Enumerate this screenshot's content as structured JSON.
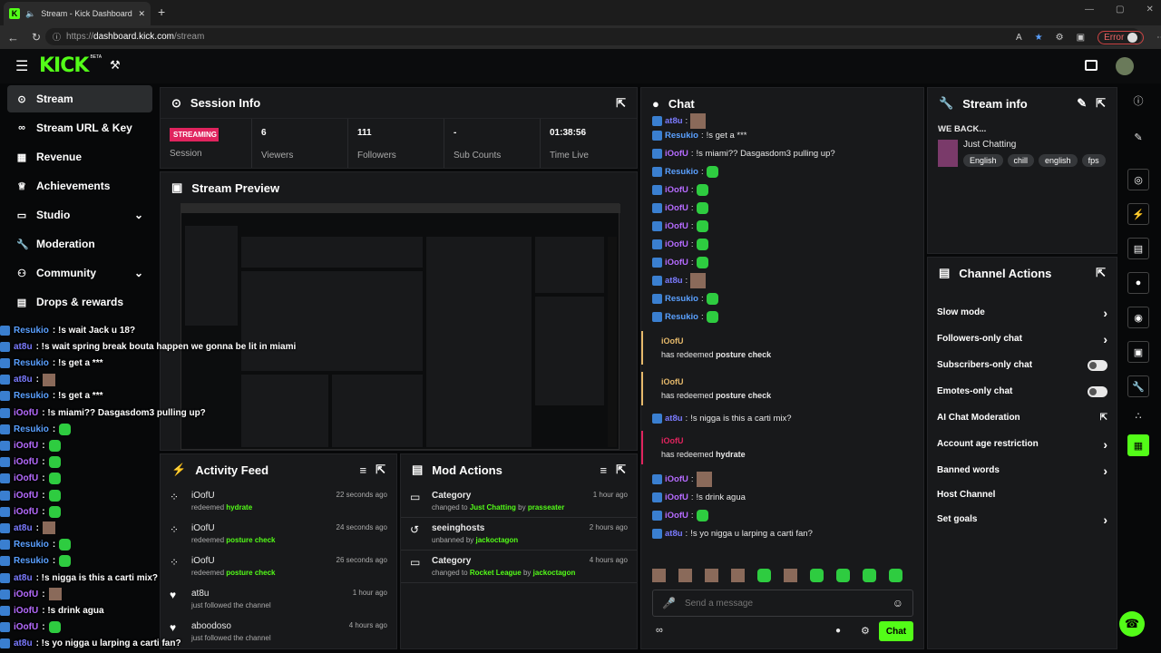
{
  "browser": {
    "tab_title": "Stream - Kick Dashboard",
    "url_prefix": "https://",
    "url_domain": "dashboard.kick.com",
    "url_path": "/stream",
    "error_label": "Error"
  },
  "app": {
    "logo": "KICK",
    "beta": "BETA"
  },
  "sidebar": {
    "items": [
      {
        "label": "Stream",
        "icon": "broadcast-icon"
      },
      {
        "label": "Stream URL & Key",
        "icon": "link-icon"
      },
      {
        "label": "Revenue",
        "icon": "revenue-icon"
      },
      {
        "label": "Achievements",
        "icon": "trophy-icon"
      },
      {
        "label": "Studio",
        "icon": "studio-icon"
      },
      {
        "label": "Moderation",
        "icon": "wrench-icon"
      },
      {
        "label": "Community",
        "icon": "community-icon"
      },
      {
        "label": "Drops & rewards",
        "icon": "drops-icon"
      }
    ]
  },
  "session": {
    "title": "Session Info",
    "status": "STREAMING",
    "status_label": "Session",
    "stats": [
      {
        "value": "6",
        "label": "Viewers"
      },
      {
        "value": "111",
        "label": "Followers"
      },
      {
        "value": "-",
        "label": "Sub Counts"
      },
      {
        "value": "01:38:56",
        "label": "Time Live"
      }
    ]
  },
  "preview": {
    "title": "Stream Preview"
  },
  "activity": {
    "title": "Activity Feed",
    "items": [
      {
        "user": "iOofU",
        "verb": "redeemed",
        "item": "hydrate",
        "time": "22 seconds ago",
        "icon": "redeem-icon"
      },
      {
        "user": "iOofU",
        "verb": "redeemed",
        "item": "posture check",
        "time": "24 seconds ago",
        "icon": "redeem-icon"
      },
      {
        "user": "iOofU",
        "verb": "redeemed",
        "item": "posture check",
        "time": "26 seconds ago",
        "icon": "redeem-icon"
      },
      {
        "user": "at8u",
        "verb": "just followed the channel",
        "item": "",
        "time": "1 hour ago",
        "icon": "heart-icon"
      },
      {
        "user": "aboodoso",
        "verb": "just followed the channel",
        "item": "",
        "time": "4 hours ago",
        "icon": "heart-icon"
      }
    ]
  },
  "modactions": {
    "title": "Mod Actions",
    "items": [
      {
        "title": "Category",
        "pre": "changed to",
        "target": "Just Chatting",
        "by": "by",
        "mod": "prasseater",
        "time": "1 hour ago"
      },
      {
        "title": "seeinghosts",
        "pre": "unbanned by",
        "target": "",
        "by": "",
        "mod": "jackoctagon",
        "time": "2 hours ago"
      },
      {
        "title": "Category",
        "pre": "changed to",
        "target": "Rocket League",
        "by": "by",
        "mod": "jackoctagon",
        "time": "4 hours ago"
      }
    ]
  },
  "chat": {
    "title": "Chat",
    "messages": [
      {
        "user": "at8u",
        "text": "",
        "emote": "pic",
        "color": "#7b7bff"
      },
      {
        "user": "Resukio",
        "text": "!s get a ***",
        "emote": "",
        "color": "#5aa0ff"
      },
      {
        "user": "iOofU",
        "text": "!s miami?? Dasgasdom3 pulling up?",
        "emote": "",
        "color": "#b56bff"
      },
      {
        "user": "Resukio",
        "text": "",
        "emote": "green",
        "color": "#5aa0ff"
      },
      {
        "user": "iOofU",
        "text": "",
        "emote": "green",
        "color": "#b56bff"
      },
      {
        "user": "iOofU",
        "text": "",
        "emote": "green",
        "color": "#b56bff"
      },
      {
        "user": "iOofU",
        "text": "",
        "emote": "green",
        "color": "#b56bff"
      },
      {
        "user": "iOofU",
        "text": "",
        "emote": "green",
        "color": "#b56bff"
      },
      {
        "user": "iOofU",
        "text": "",
        "emote": "green",
        "color": "#b56bff"
      },
      {
        "user": "at8u",
        "text": "",
        "emote": "pic",
        "color": "#7b7bff"
      },
      {
        "user": "Resukio",
        "text": "",
        "emote": "green",
        "color": "#5aa0ff"
      },
      {
        "user": "Resukio",
        "text": "",
        "emote": "green",
        "color": "#5aa0ff"
      }
    ],
    "redeems": [
      {
        "user": "iOofU",
        "label": "has redeemed",
        "item": "posture check",
        "accent": "#e5b96b"
      },
      {
        "user": "iOofU",
        "label": "has redeemed",
        "item": "posture check",
        "accent": "#e5b96b"
      }
    ],
    "mid_line": {
      "user": "at8u",
      "text": "!s nigga is this a carti mix?"
    },
    "redeem_hydrate": {
      "user": "iOofU",
      "label": "has redeemed",
      "item": "hydrate",
      "accent": "#e0245e"
    },
    "tail": [
      {
        "user": "iOofU",
        "text": "",
        "emote": "pic",
        "color": "#b56bff"
      },
      {
        "user": "iOofU",
        "text": "!s drink agua",
        "emote": "",
        "color": "#b56bff"
      },
      {
        "user": "iOofU",
        "text": "",
        "emote": "green",
        "color": "#b56bff"
      },
      {
        "user": "at8u",
        "text": "!s yo nigga u larping a carti fan?",
        "emote": "",
        "color": "#7b7bff"
      }
    ],
    "placeholder": "Send a message",
    "send_label": "Chat"
  },
  "streaminfo": {
    "title": "Stream info",
    "stream_title": "WE BACK...",
    "category": "Just Chatting",
    "tags": [
      "English",
      "chill",
      "english",
      "fps"
    ]
  },
  "channelactions": {
    "title": "Channel Actions",
    "items": [
      {
        "label": "Slow mode",
        "control": "chevron"
      },
      {
        "label": "Followers-only chat",
        "control": "chevron"
      },
      {
        "label": "Subscribers-only chat",
        "control": "toggle"
      },
      {
        "label": "Emotes-only chat",
        "control": "toggle"
      },
      {
        "label": "AI Chat Moderation",
        "control": "external"
      },
      {
        "label": "Account age restriction",
        "control": "chevron"
      },
      {
        "label": "Banned words",
        "control": "chevron"
      },
      {
        "label": "Host Channel",
        "control": "none"
      },
      {
        "label": "Set goals",
        "control": "chevron"
      }
    ]
  },
  "overlay": {
    "lines": [
      {
        "user": "Resukio",
        "text": ": !s wait Jack u 18?",
        "color": "#5aa0ff",
        "emote": ""
      },
      {
        "user": "at8u",
        "text": ": !s wait spring break bouta happen we gonna be lit in miami",
        "color": "#7b7bff",
        "emote": ""
      },
      {
        "user": "Resukio",
        "text": ": !s get a ***",
        "color": "#5aa0ff",
        "emote": ""
      },
      {
        "user": "at8u",
        "text": ":",
        "color": "#7b7bff",
        "emote": "pic"
      },
      {
        "user": "Resukio",
        "text": ": !s get a ***",
        "color": "#5aa0ff",
        "emote": ""
      },
      {
        "user": "iOofU",
        "text": ": !s miami?? Dasgasdom3 pulling up?",
        "color": "#b56bff",
        "emote": ""
      },
      {
        "user": "Resukio",
        "text": ":",
        "color": "#5aa0ff",
        "emote": "green"
      },
      {
        "user": "iOofU",
        "text": ":",
        "color": "#b56bff",
        "emote": "green"
      },
      {
        "user": "iOofU",
        "text": ":",
        "color": "#b56bff",
        "emote": "green"
      },
      {
        "user": "iOofU",
        "text": ":",
        "color": "#b56bff",
        "emote": "green"
      },
      {
        "user": "iOofU",
        "text": ":",
        "color": "#b56bff",
        "emote": "green"
      },
      {
        "user": "iOofU",
        "text": ":",
        "color": "#b56bff",
        "emote": "green"
      },
      {
        "user": "at8u",
        "text": ":",
        "color": "#7b7bff",
        "emote": "pic"
      },
      {
        "user": "Resukio",
        "text": ":",
        "color": "#5aa0ff",
        "emote": "green"
      },
      {
        "user": "Resukio",
        "text": ":",
        "color": "#5aa0ff",
        "emote": "green"
      },
      {
        "user": "at8u",
        "text": ": !s nigga is this a carti mix?",
        "color": "#7b7bff",
        "emote": ""
      },
      {
        "user": "iOofU",
        "text": ":",
        "color": "#b56bff",
        "emote": "pic"
      },
      {
        "user": "iOofU",
        "text": ": !s drink agua",
        "color": "#b56bff",
        "emote": ""
      },
      {
        "user": "iOofU",
        "text": ":",
        "color": "#b56bff",
        "emote": "green"
      },
      {
        "user": "at8u",
        "text": ": !s yo nigga u larping a carti fan?",
        "color": "#7b7bff",
        "emote": ""
      }
    ]
  },
  "colors": {
    "accent": "#53fc18",
    "panel": "#18191b",
    "streaming": "#e0245e"
  }
}
